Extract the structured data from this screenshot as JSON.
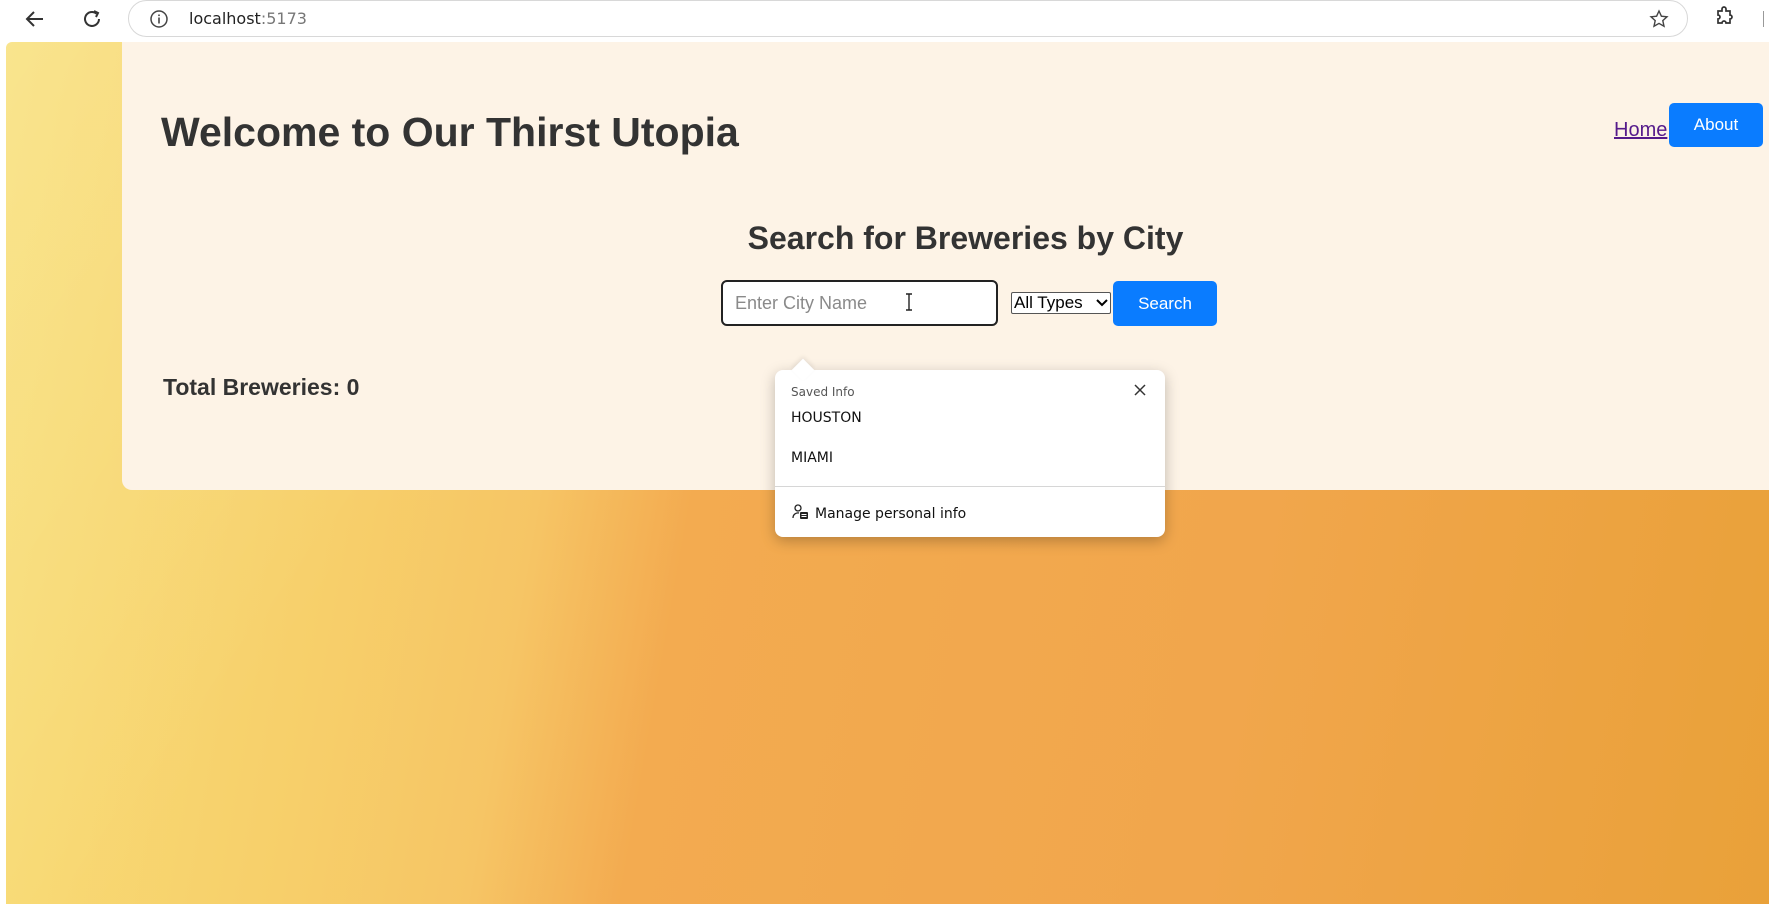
{
  "browser": {
    "url_host": "localhost",
    "url_port": ":5173"
  },
  "header": {
    "title": "Welcome to Our Thirst Utopia",
    "nav": {
      "home_label": "Home",
      "about_label": "About"
    }
  },
  "search": {
    "heading": "Search for Breweries by City",
    "city_placeholder": "Enter City Name",
    "city_value": "",
    "type_selected": "All Types",
    "button_label": "Search"
  },
  "results": {
    "total_text": "Total Breweries: 0"
  },
  "autofill_popup": {
    "header": "Saved Info",
    "items": [
      "HOUSTON",
      "MIAMI"
    ],
    "manage_label": "Manage personal info"
  },
  "colors": {
    "accent_button": "#0a7cff",
    "card_background": "#fdf3e6",
    "heading_text": "#333333"
  },
  "icons": [
    "back-arrow-icon",
    "reload-icon",
    "info-icon",
    "star-icon",
    "extensions-icon",
    "close-icon",
    "manage-info-icon",
    "chevron-down-icon",
    "text-cursor-icon"
  ]
}
